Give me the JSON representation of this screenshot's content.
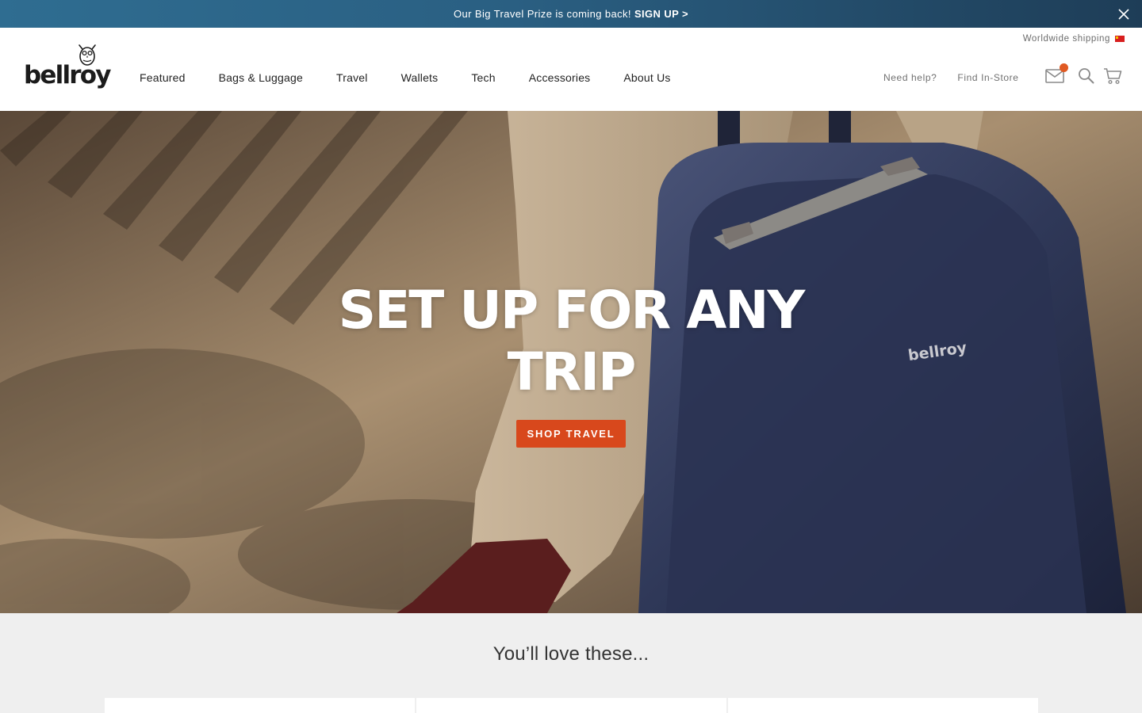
{
  "announcement": {
    "text": "Our Big Travel Prize is coming back!",
    "cta": "SIGN UP >"
  },
  "header": {
    "logo_text": "bellroy",
    "shipping": "Worldwide shipping",
    "nav": [
      "Featured",
      "Bags & Luggage",
      "Travel",
      "Wallets",
      "Tech",
      "Accessories",
      "About Us"
    ],
    "utility": [
      "Need help?",
      "Find In-Store"
    ],
    "icons": [
      "mail-icon",
      "search-icon",
      "cart-icon"
    ]
  },
  "hero": {
    "title_line1": "SET UP FOR ANY",
    "title_line2": "TRIP",
    "button": "SHOP TRAVEL",
    "bag_logo": "bellroy"
  },
  "recommendations": {
    "title": "You’ll love these..."
  },
  "colors": {
    "accent": "#d8481c",
    "notification": "#e05a23",
    "announce_bar": "#2a5f82",
    "bag_navy": "#2d3552"
  }
}
